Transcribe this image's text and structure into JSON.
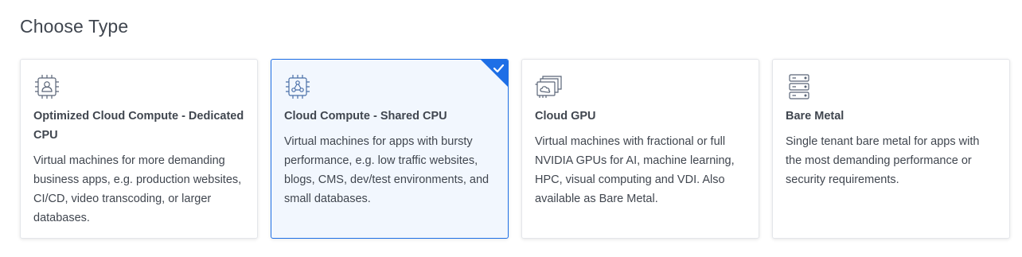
{
  "page": {
    "heading": "Choose Type"
  },
  "colors": {
    "accent": "#1e6fe6",
    "selected_bg": "#f2f7fe",
    "text": "#40464f",
    "icon_stroke": "#5a6577"
  },
  "cards": [
    {
      "id": "optimized-cloud-compute",
      "icon": "cpu-chip-user-icon",
      "title": "Optimized Cloud Compute - Dedicated CPU",
      "description": "Virtual machines for more demanding business apps, e.g. production websites, CI/CD, video transcoding, or larger databases.",
      "selected": false
    },
    {
      "id": "cloud-compute-shared",
      "icon": "cpu-chip-network-icon",
      "title": "Cloud Compute - Shared CPU",
      "description": "Virtual machines for apps with bursty performance, e.g. low traffic websites, blogs, CMS, dev/test environments, and small databases.",
      "selected": true
    },
    {
      "id": "cloud-gpu",
      "icon": "gpu-cards-icon",
      "title": "Cloud GPU",
      "description": "Virtual machines with fractional or full NVIDIA GPUs for AI, machine learning, HPC, visual computing and VDI. Also available as Bare Metal.",
      "selected": false
    },
    {
      "id": "bare-metal",
      "icon": "server-rack-icon",
      "title": "Bare Metal",
      "description": "Single tenant bare metal for apps with the most demanding performance or security requirements.",
      "selected": false
    }
  ]
}
